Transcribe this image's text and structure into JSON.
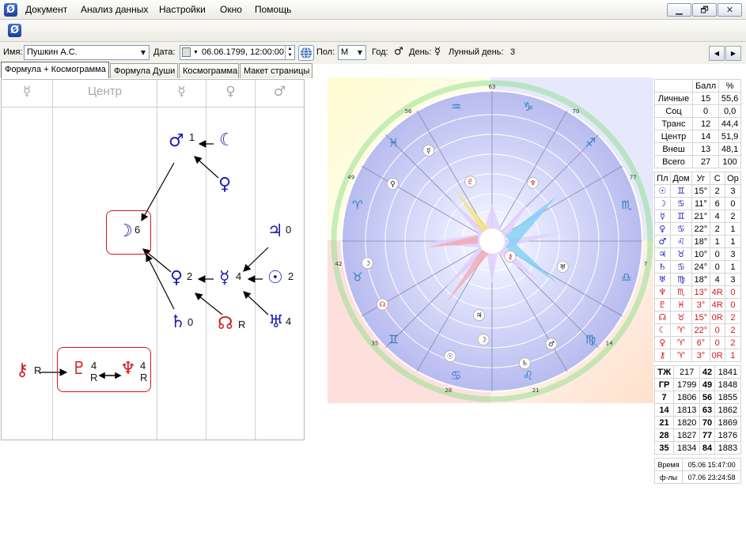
{
  "menu": [
    "Документ",
    "Анализ данных",
    "Настройки",
    "Окно",
    "Помощь"
  ],
  "window_buttons": [
    "▁",
    "🗗",
    "✕"
  ],
  "params": {
    "name_label": "Имя:",
    "name_value": "Пушкин А.С.",
    "date_label": "Дата:",
    "date_value": "06.06.1799, 12:00:00",
    "sex_label": "Пол:",
    "sex_value": "М",
    "year_label": "Год:",
    "year_symbol": "♂",
    "day_label": "День:",
    "day_symbol": "☿",
    "lunar_label": "Лунный день:",
    "lunar_value": "3"
  },
  "tabs": [
    "Формула + Космограмма",
    "Формула Души",
    "Космограмма",
    "Макет страницы"
  ],
  "formula": {
    "columns": [
      "☿",
      "Центр",
      "☿",
      "♀",
      "♂"
    ],
    "planets": [
      {
        "sym": "♂",
        "num": "1"
      },
      {
        "sym": "☾",
        "num": ""
      },
      {
        "sym": "♀",
        "num": ""
      },
      {
        "sym": "☽",
        "num": "6"
      },
      {
        "sym": "♃",
        "num": "0"
      },
      {
        "sym": "♀",
        "num": "2"
      },
      {
        "sym": "☿",
        "num": "4"
      },
      {
        "sym": "☉",
        "num": "2"
      },
      {
        "sym": "♄",
        "num": "0"
      },
      {
        "sym": "☊",
        "num": "R"
      },
      {
        "sym": "♅",
        "num": "4"
      },
      {
        "sym": "⚷",
        "num": "R"
      },
      {
        "sym": "♇",
        "num": "4",
        "r": "R"
      },
      {
        "sym": "♆",
        "num": "4",
        "r": "R"
      }
    ]
  },
  "cosmogram": {
    "degree_labels": [
      "63",
      "70",
      "77",
      "7",
      "14",
      "21",
      "28",
      "35",
      "42",
      "49",
      "56"
    ],
    "zodiac": [
      "♑",
      "♐",
      "♏",
      "♎",
      "♍",
      "♌",
      "♋",
      "♊",
      "♉",
      "♈",
      "♓",
      "♒"
    ],
    "markers": [
      "♆",
      "♇",
      "☿",
      "♀",
      "☽",
      "♅",
      "☽",
      "☉",
      "♃",
      "♂",
      "♄",
      "☊",
      "⚷"
    ]
  },
  "stats": {
    "headers": [
      "",
      "Балл",
      "%"
    ],
    "rows": [
      [
        "Личные",
        "15",
        "55,6"
      ],
      [
        "Соц",
        "0",
        "0,0"
      ],
      [
        "Транс",
        "12",
        "44,4"
      ],
      [
        "Центр",
        "14",
        "51,9"
      ],
      [
        "Внеш",
        "13",
        "48,1"
      ],
      [
        "Всего",
        "27",
        "100"
      ]
    ]
  },
  "planet_table": {
    "headers": [
      "Пл",
      "Дом",
      "Уг",
      "С",
      "Ор"
    ],
    "rows": [
      [
        "☉",
        "♊",
        "15°",
        "2",
        "3"
      ],
      [
        "☽",
        "♋",
        "11°",
        "6",
        "0"
      ],
      [
        "☿",
        "♊",
        "21°",
        "4",
        "2"
      ],
      [
        "♀",
        "♋",
        "22°",
        "2",
        "1"
      ],
      [
        "♂",
        "♌",
        "18°",
        "1",
        "1"
      ],
      [
        "♃",
        "♉",
        "10°",
        "0",
        "3"
      ],
      [
        "♄",
        "♋",
        "24°",
        "0",
        "1"
      ],
      [
        "♅",
        "♍",
        "18°",
        "4",
        "3"
      ],
      [
        "♆",
        "♏",
        "13°",
        "4R",
        "0"
      ],
      [
        "♇",
        "♓",
        "3°",
        "4R",
        "0"
      ],
      [
        "☊",
        "♉",
        "15°",
        "0R",
        "2"
      ],
      [
        "☾",
        "♈",
        "22°",
        "0",
        "2"
      ],
      [
        "♀",
        "♈",
        "6°",
        "0",
        "2"
      ],
      [
        "⚷",
        "♈",
        "3°",
        "0R",
        "1"
      ]
    ],
    "red_rows": [
      8,
      9,
      10,
      11,
      12,
      13
    ]
  },
  "years_table": [
    [
      "ТЖ",
      "217",
      "42",
      "1841"
    ],
    [
      "ГР",
      "1799",
      "49",
      "1848"
    ],
    [
      "7",
      "1806",
      "56",
      "1855"
    ],
    [
      "14",
      "1813",
      "63",
      "1862"
    ],
    [
      "21",
      "1820",
      "70",
      "1869"
    ],
    [
      "28",
      "1827",
      "77",
      "1876"
    ],
    [
      "35",
      "1834",
      "84",
      "1883"
    ]
  ],
  "time_table": [
    [
      "Время",
      "05.06 15:47:00"
    ],
    [
      "ф-лы",
      "07.06 23:24:58"
    ]
  ],
  "colors": {
    "blue": "#1d1db5",
    "red": "#d21a1a",
    "accent": "#3d6fd6"
  }
}
